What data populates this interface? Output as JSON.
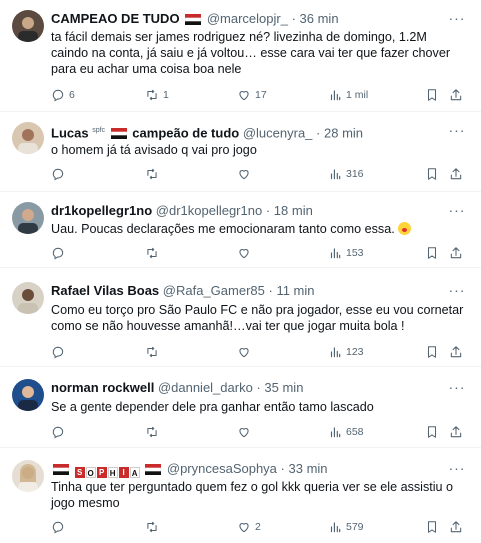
{
  "tweets": [
    {
      "name": "CAMPEAO DE TUDO",
      "handle": "@marcelopjr_",
      "dot": "·",
      "time": "36 min",
      "text": "ta fácil demais ser james rodriguez né? livezinha de domingo, 1.2M caindo na conta, já saiu e já voltou… esse cara vai ter que fazer chover para eu achar uma coisa boa nele",
      "replies": "6",
      "retweets": "1",
      "likes": "17",
      "views": "1 mil"
    },
    {
      "name": "Lucas",
      "superscript": "spfc",
      "name_suffix": "campeão de tudo",
      "handle": "@lucenyra_",
      "dot": "·",
      "time": "28 min",
      "text": "o homem já tá avisado q vai pro jogo",
      "replies": "",
      "retweets": "",
      "likes": "",
      "views": "316"
    },
    {
      "name": "dr1kopellegr1no",
      "handle": "@dr1kopellegr1no",
      "dot": "·",
      "time": "18 min",
      "text": "Uau. Poucas declarações me emocionaram tanto como essa.",
      "replies": "",
      "retweets": "",
      "likes": "",
      "views": "153"
    },
    {
      "name": "Rafael Vilas Boas",
      "handle": "@Rafa_Gamer85",
      "dot": "·",
      "time": "11 min",
      "text": "Como eu torço pro São Paulo FC e não pra jogador, esse eu vou cornetar como se não houvesse amanhã!…vai ter que jogar muita bola !",
      "replies": "",
      "retweets": "",
      "likes": "",
      "views": "123"
    },
    {
      "name": "norman rockwell",
      "handle": "@danniel_darko",
      "dot": "·",
      "time": "35 min",
      "text": "Se a gente depender dele pra ganhar então tamo lascado",
      "replies": "",
      "retweets": "",
      "likes": "",
      "views": "658"
    },
    {
      "name_letters": [
        "S",
        "O",
        "P",
        "H",
        "I",
        "A"
      ],
      "handle": "@pryncesaSophya",
      "dot": "·",
      "time": "33 min",
      "text": "Tinha que ter perguntado quem fez o gol kkk queria ver se ele assistiu o jogo mesmo",
      "replies": "",
      "retweets": "",
      "likes": "2",
      "views": "579"
    }
  ],
  "icons": {
    "more": "more-horizontal-icon",
    "reply": "reply-icon",
    "retweet": "retweet-icon",
    "like": "heart-icon",
    "views": "views-icon",
    "bookmark": "bookmark-icon",
    "share": "share-icon"
  },
  "colors": {
    "text": "#0f1419",
    "secondary": "#536471",
    "divider": "#eff3f4",
    "flag_red": "#c92a2a",
    "flag_black": "#111111"
  }
}
